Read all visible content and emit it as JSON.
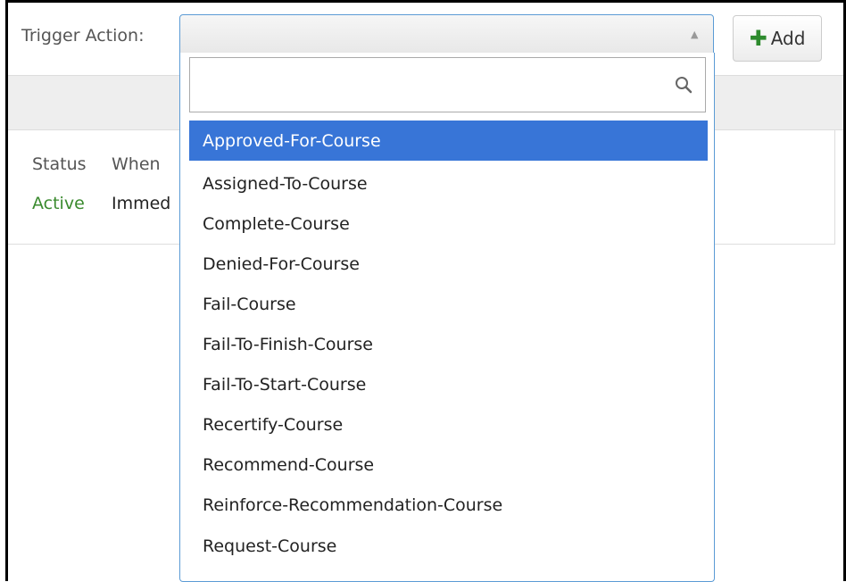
{
  "form": {
    "trigger_label": "Trigger Action:"
  },
  "toolbar": {
    "add_label": "Add",
    "add_icon": "plus-icon"
  },
  "table": {
    "headers": {
      "status": "Status",
      "when": "When"
    },
    "row": {
      "status": "Active",
      "when": "Immed"
    }
  },
  "dropdown": {
    "search": {
      "value": "",
      "placeholder": "",
      "icon": "search-icon"
    },
    "highlighted_index": 0,
    "options": [
      "Approved-For-Course",
      "Assigned-To-Course",
      "Complete-Course",
      "Denied-For-Course",
      "Fail-Course",
      "Fail-To-Finish-Course",
      "Fail-To-Start-Course",
      "Recertify-Course",
      "Recommend-Course",
      "Reinforce-Recommendation-Course",
      "Request-Course"
    ]
  },
  "colors": {
    "highlight": "#3875d7",
    "active_status": "#3a8a2e",
    "add_icon": "#2e8b2e",
    "select_border": "#5b9bd5"
  }
}
